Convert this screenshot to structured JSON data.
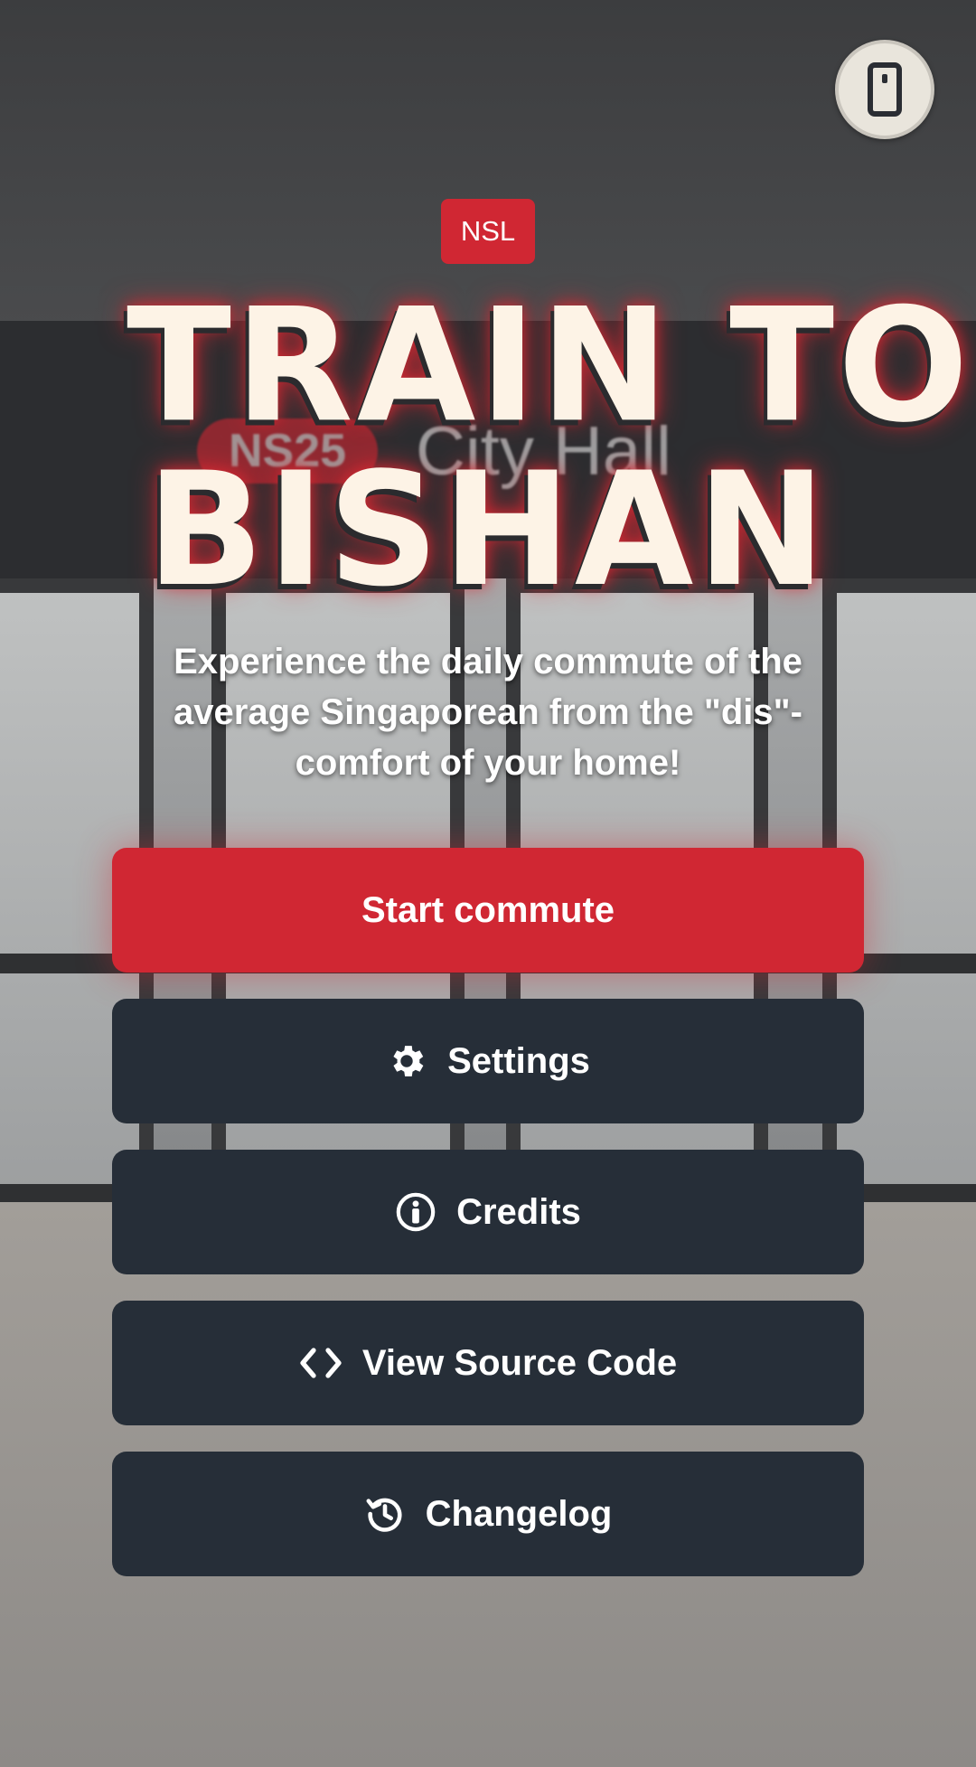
{
  "rotate_button": {
    "icon": "phone-icon"
  },
  "line_badge": "NSL",
  "background_sign": {
    "code": "NS25",
    "station": "City Hall"
  },
  "title": {
    "line1": "TRAIN TO",
    "line2": "BISHAN"
  },
  "subtitle": "Experience the daily commute of the average Singaporean from the \"dis\"-comfort of your home!",
  "buttons": {
    "start": "Start commute",
    "settings": "Settings",
    "credits": "Credits",
    "source": "View Source Code",
    "changelog": "Changelog"
  },
  "colors": {
    "accent_red": "#d02733",
    "button_dark": "#262e38",
    "title_cream": "#fdf3e6"
  }
}
